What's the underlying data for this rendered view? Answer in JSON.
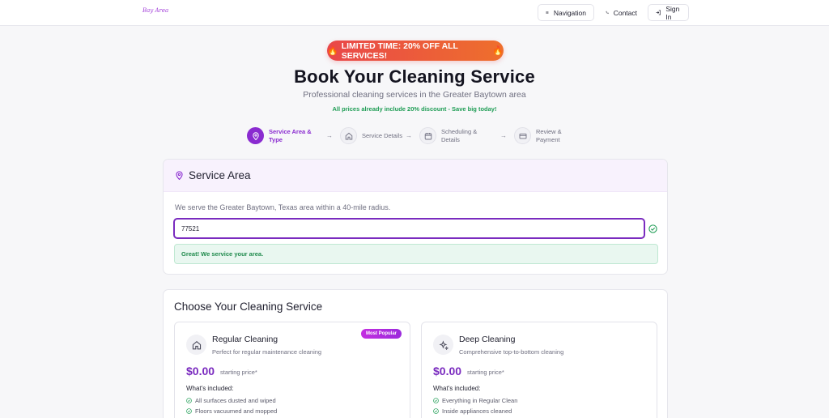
{
  "header": {
    "logo_text": "Bay Area",
    "nav_label": "Navigation",
    "contact_label": "Contact",
    "signin_label": "Sign In"
  },
  "promo": {
    "text": "LIMITED TIME: 20% OFF ALL SERVICES!",
    "icon": "fire-icon"
  },
  "hero": {
    "title": "Book Your Cleaning Service",
    "subtitle": "Professional cleaning services in the Greater Baytown area",
    "note": "All prices already include 20% discount - Save big today!"
  },
  "steps": [
    {
      "label": "Service Area & Type",
      "icon": "map-pin-icon",
      "active": true
    },
    {
      "label": "Service Details",
      "icon": "home-icon",
      "active": false
    },
    {
      "label": "Scheduling & Details",
      "icon": "calendar-icon",
      "active": false
    },
    {
      "label": "Review & Payment",
      "icon": "credit-card-icon",
      "active": false
    }
  ],
  "service_area": {
    "title": "Service Area",
    "description": "We serve the Greater Baytown, Texas area within a 40-mile radius.",
    "zip_value": "77521",
    "success_message": "Great! We service your area."
  },
  "choose": {
    "title": "Choose Your Cleaning Service",
    "services": [
      {
        "name": "Regular Cleaning",
        "description": "Perfect for regular maintenance cleaning",
        "badge": "Most Popular",
        "price": "$0.00",
        "price_note": "starting price*",
        "included_label": "What's included:",
        "features": [
          "All surfaces dusted and wiped",
          "Floors vacuumed and mopped"
        ]
      },
      {
        "name": "Deep Cleaning",
        "description": "Comprehensive top-to-bottom cleaning",
        "price": "$0.00",
        "price_note": "starting price*",
        "included_label": "What's included:",
        "features": [
          "Everything in Regular Clean",
          "Inside appliances cleaned"
        ]
      }
    ]
  },
  "colors": {
    "accent": "#8a2bd0",
    "success": "#1f8a4c",
    "promo_start": "#e9474a",
    "promo_end": "#ee6f2c"
  }
}
